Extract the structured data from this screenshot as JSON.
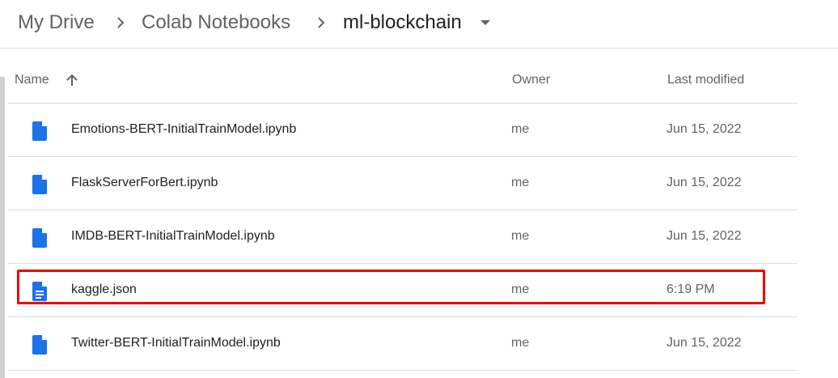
{
  "breadcrumb": {
    "items": [
      "My Drive",
      "Colab Notebooks"
    ],
    "current": "ml-blockchain"
  },
  "table": {
    "headers": {
      "name": "Name",
      "owner": "Owner",
      "modified": "Last modified"
    },
    "sort": "ascending",
    "rows": [
      {
        "name": "Emotions-BERT-InitialTrainModel.ipynb",
        "owner": "me",
        "modified": "Jun 15, 2022",
        "icon": "file-icon"
      },
      {
        "name": "FlaskServerForBert.ipynb",
        "owner": "me",
        "modified": "Jun 15, 2022",
        "icon": "file-icon"
      },
      {
        "name": "IMDB-BERT-InitialTrainModel.ipynb",
        "owner": "me",
        "modified": "Jun 15, 2022",
        "icon": "file-icon"
      },
      {
        "name": "kaggle.json",
        "owner": "me",
        "modified": "6:19 PM",
        "icon": "document-icon",
        "highlighted": true
      },
      {
        "name": "Twitter-BERT-InitialTrainModel.ipynb",
        "owner": "me",
        "modified": "Jun 15, 2022",
        "icon": "file-icon"
      }
    ]
  },
  "colors": {
    "icon_blue": "#1a73e8",
    "highlight_red": "#ee0000",
    "divider": "#dadce0"
  }
}
